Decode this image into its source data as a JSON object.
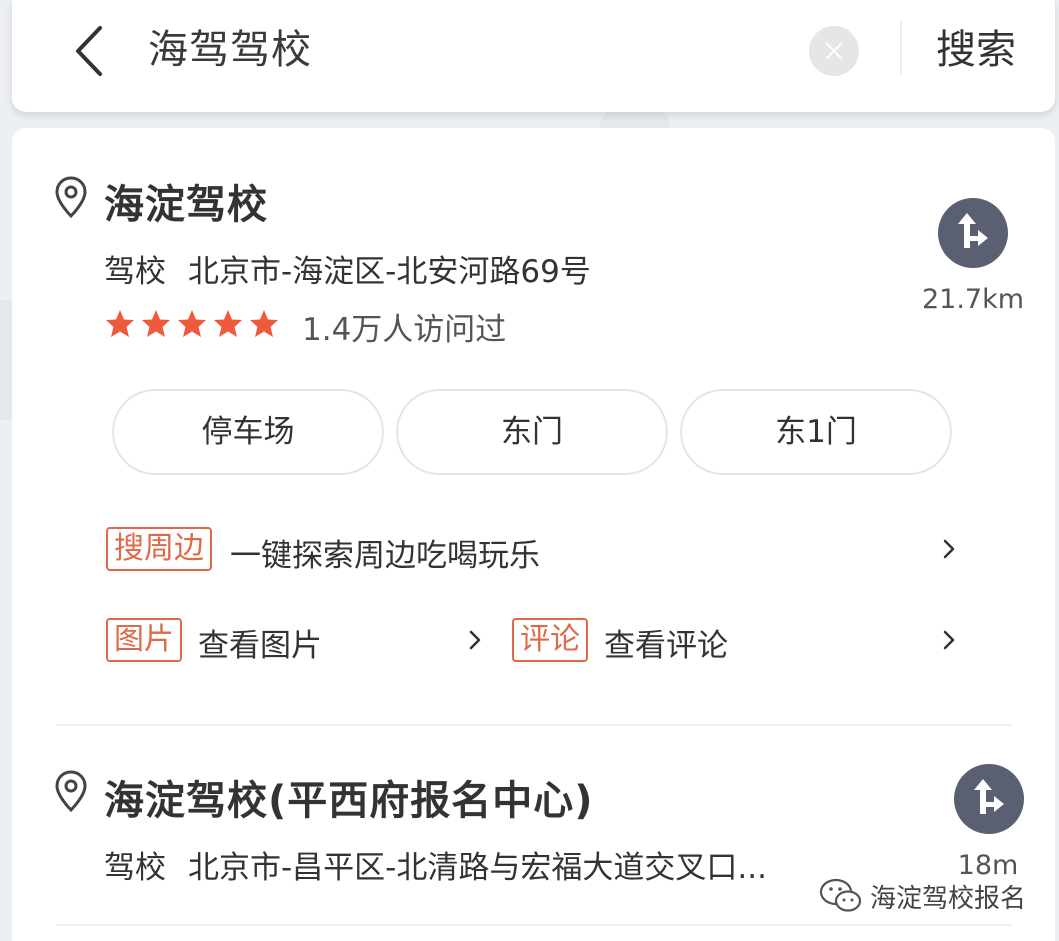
{
  "search": {
    "query": "海驾驾校",
    "submit_label": "搜索"
  },
  "results": [
    {
      "name": "海淀驾校",
      "category": "驾校",
      "address": "北京市-海淀区-北安河路69号",
      "rating_stars": 5,
      "visits": "1.4万人访问过",
      "distance": "21.7km",
      "entrances": [
        "停车场",
        "东门",
        "东1门"
      ],
      "nearby": {
        "tag": "搜周边",
        "text": "一键探索周边吃喝玩乐"
      },
      "photos": {
        "tag": "图片",
        "text": "查看图片"
      },
      "reviews": {
        "tag": "评论",
        "text": "查看评论"
      }
    },
    {
      "name": "海淀驾校(平西府报名中心)",
      "category": "驾校",
      "address": "北京市-昌平区-北清路与宏福大道交叉口...",
      "distance": "18m"
    }
  ],
  "watermark": {
    "text": "海淀驾校报名",
    "icon": "wechat-icon"
  },
  "colors": {
    "accent": "#e06a48",
    "star": "#f05a3c",
    "nav_button": "#5a6072"
  }
}
